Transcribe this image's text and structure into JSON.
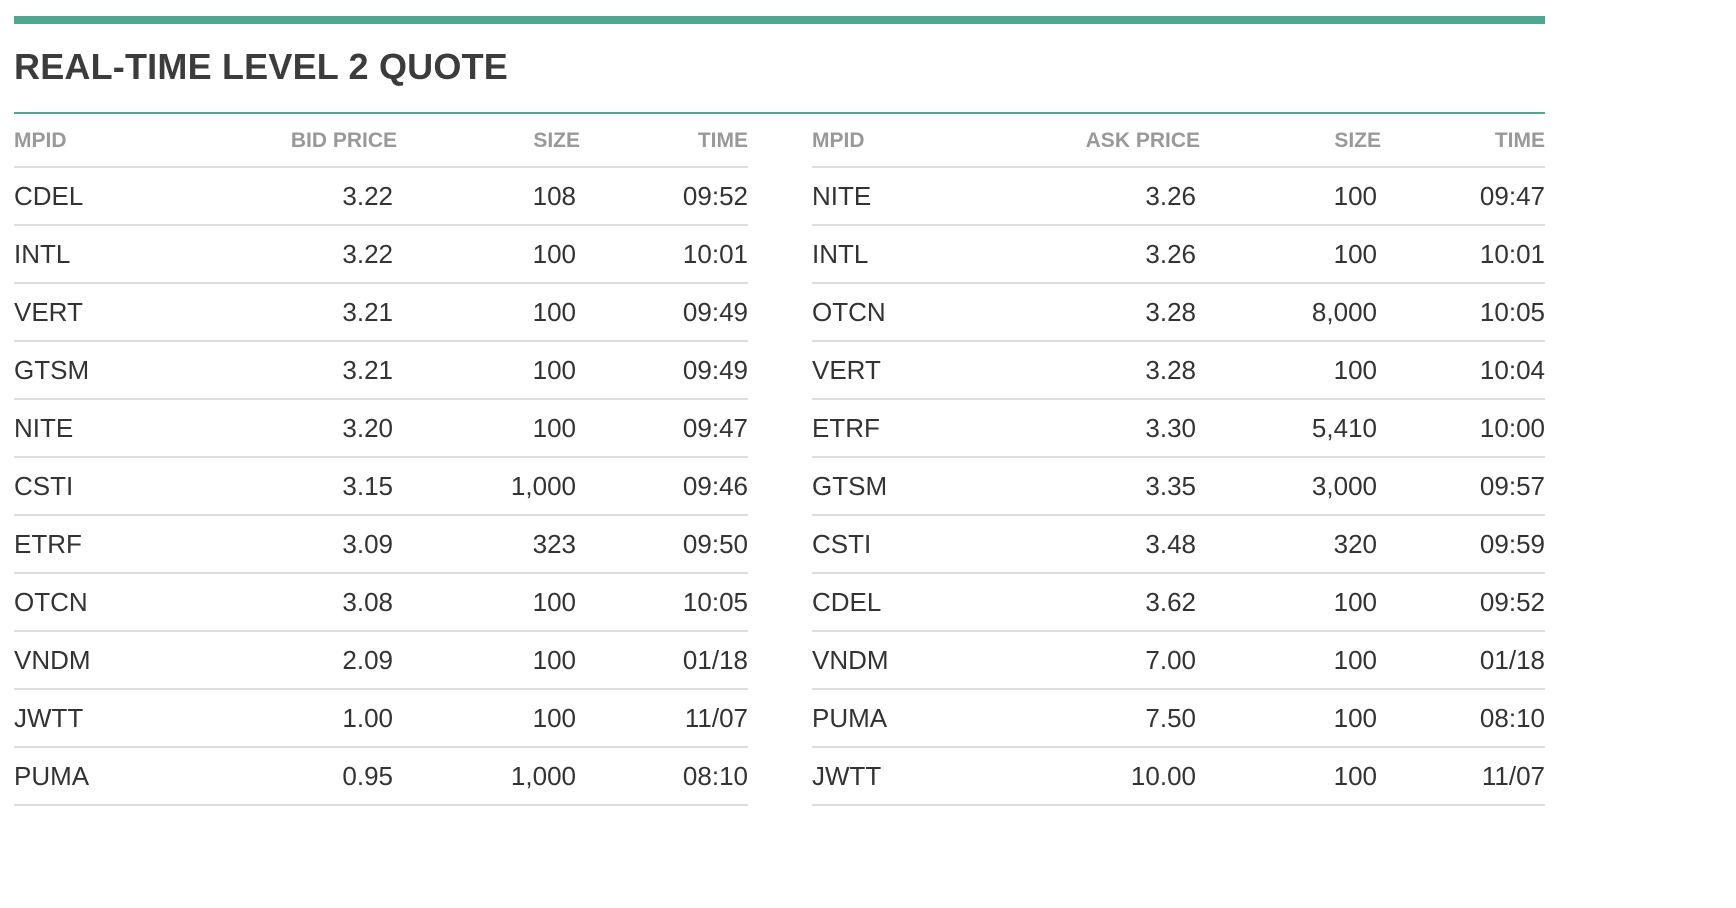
{
  "title": "REAL-TIME LEVEL 2 QUOTE",
  "colors": {
    "accent": "#4fa791",
    "header_text": "#999999",
    "body_text": "#333333",
    "divider": "#dddddd"
  },
  "bid": {
    "headers": {
      "mpid": "MPID",
      "price": "BID PRICE",
      "size": "SIZE",
      "time": "TIME"
    },
    "rows": [
      {
        "mpid": "CDEL",
        "price": "3.22",
        "size": "108",
        "time": "09:52"
      },
      {
        "mpid": "INTL",
        "price": "3.22",
        "size": "100",
        "time": "10:01"
      },
      {
        "mpid": "VERT",
        "price": "3.21",
        "size": "100",
        "time": "09:49"
      },
      {
        "mpid": "GTSM",
        "price": "3.21",
        "size": "100",
        "time": "09:49"
      },
      {
        "mpid": "NITE",
        "price": "3.20",
        "size": "100",
        "time": "09:47"
      },
      {
        "mpid": "CSTI",
        "price": "3.15",
        "size": "1,000",
        "time": "09:46"
      },
      {
        "mpid": "ETRF",
        "price": "3.09",
        "size": "323",
        "time": "09:50"
      },
      {
        "mpid": "OTCN",
        "price": "3.08",
        "size": "100",
        "time": "10:05"
      },
      {
        "mpid": "VNDM",
        "price": "2.09",
        "size": "100",
        "time": "01/18"
      },
      {
        "mpid": "JWTT",
        "price": "1.00",
        "size": "100",
        "time": "11/07"
      },
      {
        "mpid": "PUMA",
        "price": "0.95",
        "size": "1,000",
        "time": "08:10"
      }
    ]
  },
  "ask": {
    "headers": {
      "mpid": "MPID",
      "price": "ASK PRICE",
      "size": "SIZE",
      "time": "TIME"
    },
    "rows": [
      {
        "mpid": "NITE",
        "price": "3.26",
        "size": "100",
        "time": "09:47"
      },
      {
        "mpid": "INTL",
        "price": "3.26",
        "size": "100",
        "time": "10:01"
      },
      {
        "mpid": "OTCN",
        "price": "3.28",
        "size": "8,000",
        "time": "10:05"
      },
      {
        "mpid": "VERT",
        "price": "3.28",
        "size": "100",
        "time": "10:04"
      },
      {
        "mpid": "ETRF",
        "price": "3.30",
        "size": "5,410",
        "time": "10:00"
      },
      {
        "mpid": "GTSM",
        "price": "3.35",
        "size": "3,000",
        "time": "09:57"
      },
      {
        "mpid": "CSTI",
        "price": "3.48",
        "size": "320",
        "time": "09:59"
      },
      {
        "mpid": "CDEL",
        "price": "3.62",
        "size": "100",
        "time": "09:52"
      },
      {
        "mpid": "VNDM",
        "price": "7.00",
        "size": "100",
        "time": "01/18"
      },
      {
        "mpid": "PUMA",
        "price": "7.50",
        "size": "100",
        "time": "08:10"
      },
      {
        "mpid": "JWTT",
        "price": "10.00",
        "size": "100",
        "time": "11/07"
      }
    ]
  }
}
